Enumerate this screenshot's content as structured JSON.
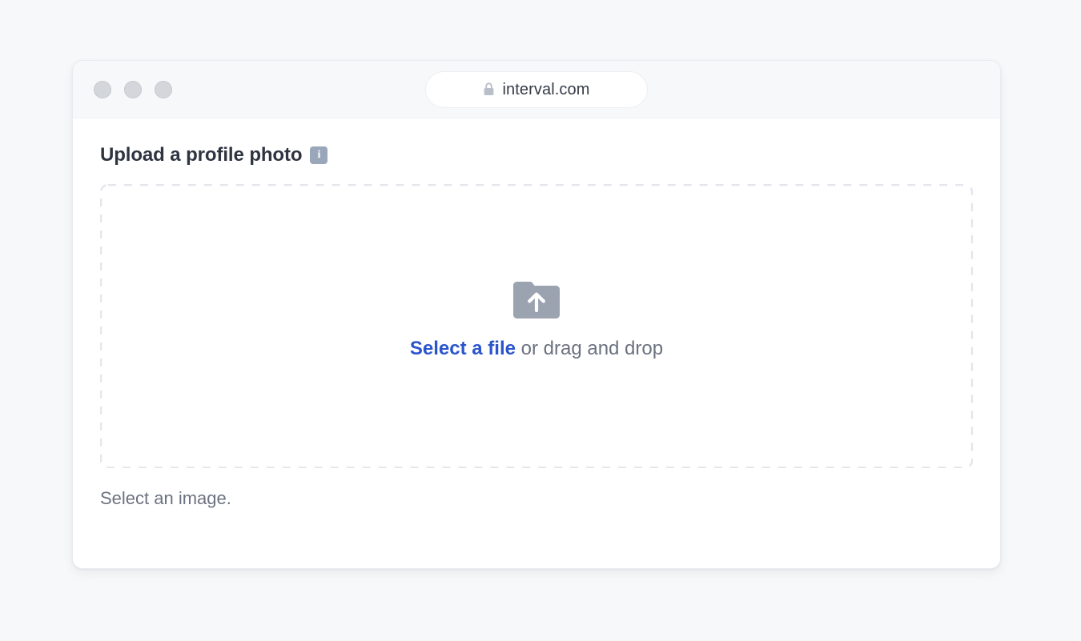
{
  "page": {
    "background_color": "#f6f8fa"
  },
  "browser": {
    "traffic_lights": [
      {
        "name": "close",
        "color": "#d3d6db"
      },
      {
        "name": "minimize",
        "color": "#d3d6db"
      },
      {
        "name": "maximize",
        "color": "#d3d6db"
      }
    ],
    "address_bar": {
      "lock_icon": "lock-icon",
      "url": "interval.com",
      "secure": true
    }
  },
  "form": {
    "label": "Upload a profile photo",
    "info_badge": {
      "icon": "info-icon",
      "glyph": "i",
      "color": "#9aa7ba"
    },
    "dropzone": {
      "icon": "folder-upload-icon",
      "icon_color": "#9aa3af",
      "link_text": "Select a file",
      "link_color": "#2b55cc",
      "rest_text": " or drag and drop",
      "border_style": "dashed",
      "border_color": "#e3e6eb"
    },
    "help_text": "Select an image."
  }
}
